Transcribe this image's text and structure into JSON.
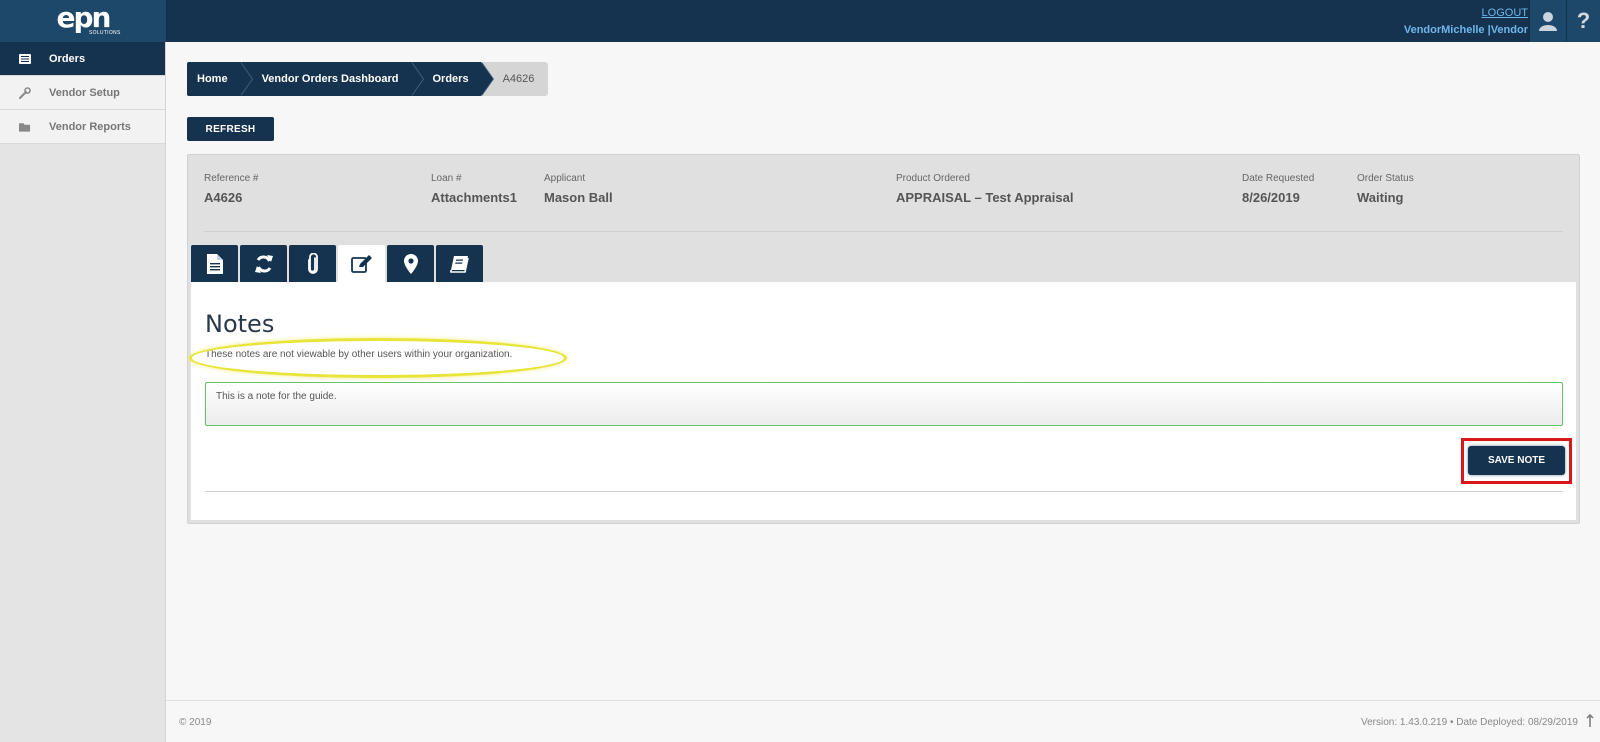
{
  "header": {
    "logo_text": "epn",
    "logo_sub": "SOLUTIONS",
    "logout_label": "LOGOUT",
    "username": "VendorMichelle",
    "separator": "|",
    "role": "Vendor",
    "user_icon": "user-icon",
    "help_label": "?"
  },
  "sidebar": {
    "items": [
      {
        "label": "Orders",
        "icon": "list-icon",
        "active": true
      },
      {
        "label": "Vendor Setup",
        "icon": "wrench-icon",
        "active": false
      },
      {
        "label": "Vendor Reports",
        "icon": "folder-icon",
        "active": false
      }
    ]
  },
  "breadcrumb": [
    "Home",
    "Vendor Orders Dashboard",
    "Orders",
    "A4626"
  ],
  "refresh_label": "REFRESH",
  "order": {
    "reference_label": "Reference #",
    "reference": "A4626",
    "loan_label": "Loan #",
    "loan": "Attachments1",
    "applicant_label": "Applicant",
    "applicant": "Mason Ball",
    "product_label": "Product Ordered",
    "product": "APPRAISAL – Test Appraisal",
    "date_label": "Date Requested",
    "date": "8/26/2019",
    "status_label": "Order Status",
    "status": "Waiting"
  },
  "tabs": [
    {
      "icon": "document-icon",
      "active": false
    },
    {
      "icon": "refresh-icon",
      "active": false
    },
    {
      "icon": "paperclip-icon",
      "active": false
    },
    {
      "icon": "edit-icon",
      "active": true
    },
    {
      "icon": "map-marker-icon",
      "active": false
    },
    {
      "icon": "book-icon",
      "active": false
    }
  ],
  "notes": {
    "title": "Notes",
    "subtitle": "These notes are not viewable by other users within your organization.",
    "note_value": "This is a note for the guide.",
    "save_label": "SAVE NOTE"
  },
  "footer": {
    "copyright": "© 2019",
    "version": "Version: 1.43.0.219  •  Date Deployed: 08/29/2019"
  },
  "colors": {
    "navy": "#15334f",
    "accent_blue": "#6fb6ea",
    "highlight_yellow": "#e8e43a",
    "highlight_red": "#d8161c",
    "field_border": "#6abf6a"
  }
}
